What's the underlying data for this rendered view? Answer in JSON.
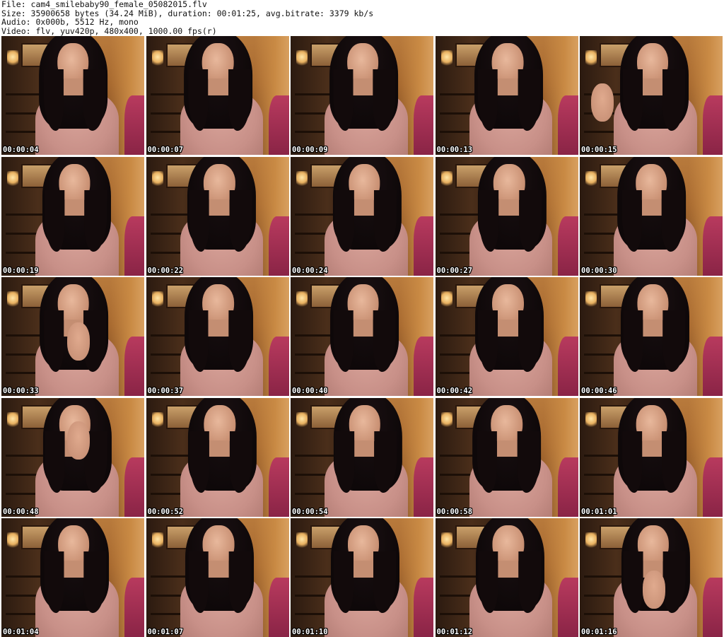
{
  "header": {
    "line1": "File: cam4_smilebaby90_female_05082015.flv",
    "line2": "Size: 35900658 bytes (34.24 MiB), duration: 00:01:25, avg.bitrate: 3379 kb/s",
    "line3": "Audio: 0x000b, 5512 Hz, mono",
    "line4": "Video: flv, yuv420p, 480x400, 1000.00 fps(r)"
  },
  "thumbnails": [
    {
      "timestamp": "00:00:04"
    },
    {
      "timestamp": "00:00:07"
    },
    {
      "timestamp": "00:00:09"
    },
    {
      "timestamp": "00:00:13"
    },
    {
      "timestamp": "00:00:15"
    },
    {
      "timestamp": "00:00:19"
    },
    {
      "timestamp": "00:00:22"
    },
    {
      "timestamp": "00:00:24"
    },
    {
      "timestamp": "00:00:27"
    },
    {
      "timestamp": "00:00:30"
    },
    {
      "timestamp": "00:00:33"
    },
    {
      "timestamp": "00:00:37"
    },
    {
      "timestamp": "00:00:40"
    },
    {
      "timestamp": "00:00:42"
    },
    {
      "timestamp": "00:00:46"
    },
    {
      "timestamp": "00:00:48"
    },
    {
      "timestamp": "00:00:52"
    },
    {
      "timestamp": "00:00:54"
    },
    {
      "timestamp": "00:00:58"
    },
    {
      "timestamp": "00:01:01"
    },
    {
      "timestamp": "00:01:04"
    },
    {
      "timestamp": "00:01:07"
    },
    {
      "timestamp": "00:01:10"
    },
    {
      "timestamp": "00:01:12"
    },
    {
      "timestamp": "00:01:16"
    }
  ]
}
